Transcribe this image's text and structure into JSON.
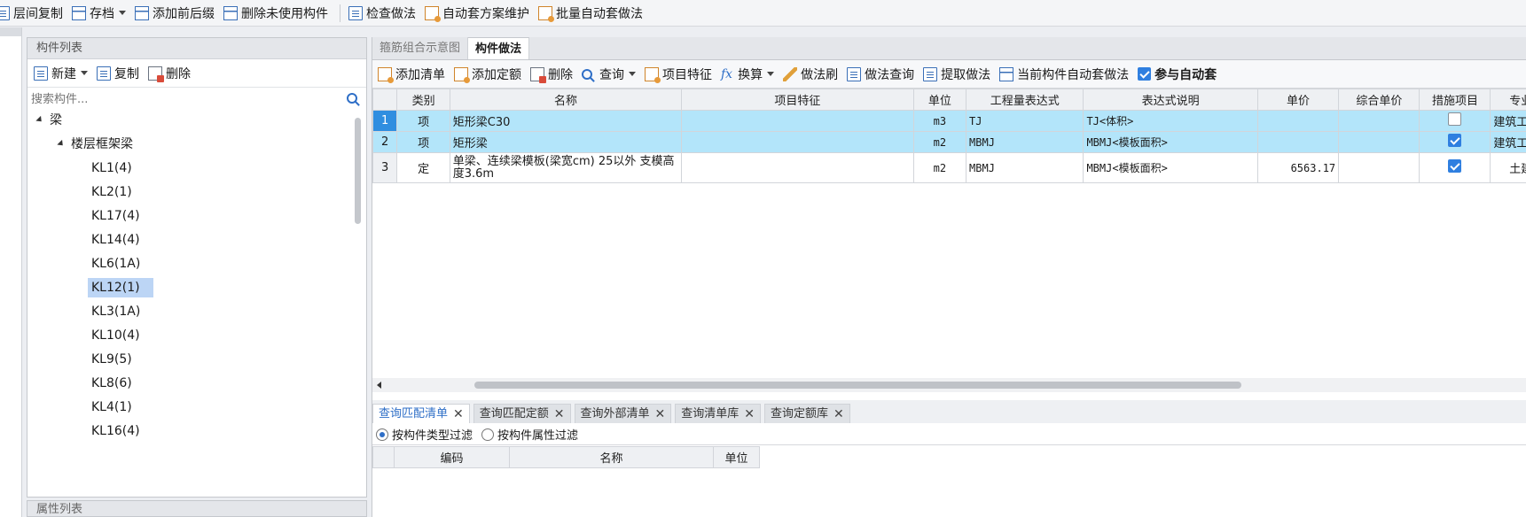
{
  "toolbar": {
    "items": [
      "层间复制",
      "存档",
      "添加前后缀",
      "删除未使用构件",
      "检查做法",
      "自动套方案维护",
      "批量自动套做法"
    ]
  },
  "component_panel": {
    "title": "构件列表",
    "tools": [
      "新建",
      "复制",
      "删除"
    ],
    "search_placeholder": "搜索构件...",
    "tree": {
      "root": "梁",
      "group": "楼层框架梁",
      "leaves": [
        "KL1(4)",
        "KL2(1)",
        "KL17(4)",
        "KL14(4)",
        "KL6(1A)",
        "KL12(1)",
        "KL3(1A)",
        "KL10(4)",
        "KL9(5)",
        "KL8(6)",
        "KL4(1)",
        "KL16(4)"
      ],
      "selected": "KL12(1)"
    }
  },
  "properties_panel": {
    "title": "属性列表"
  },
  "main": {
    "tabs": [
      "箍筋组合示意图",
      "构件做法"
    ],
    "active_tab": "构件做法",
    "tools": [
      "添加清单",
      "添加定额",
      "删除",
      "查询",
      "项目特征",
      "换算",
      "做法刷",
      "做法查询",
      "提取做法",
      "当前构件自动套做法",
      "参与自动套"
    ],
    "auto_apply_checked": true,
    "columns": [
      "类别",
      "名称",
      "项目特征",
      "单位",
      "工程量表达式",
      "表达式说明",
      "单价",
      "综合单价",
      "措施项目",
      "专业"
    ],
    "rows": [
      {
        "num": "1",
        "type": "项",
        "name": "矩形梁C30",
        "feature": "",
        "unit": "m3",
        "expr": "TJ",
        "desc": "TJ<体积>",
        "price": "",
        "total": "",
        "measure": false,
        "major": "建筑工"
      },
      {
        "num": "2",
        "type": "项",
        "name": "矩形梁",
        "feature": "",
        "unit": "m2",
        "expr": "MBMJ",
        "desc": "MBMJ<模板面积>",
        "price": "",
        "total": "",
        "measure": true,
        "major": "建筑工"
      },
      {
        "num": "3",
        "type": "定",
        "name": "单梁、连续梁模板(梁宽cm) 25以外 支模高度3.6m",
        "feature": "",
        "unit": "m2",
        "expr": "MBMJ",
        "desc": "MBMJ<模板面积>",
        "price": "6563.17",
        "total": "",
        "measure": true,
        "major": "土建"
      }
    ],
    "bottom_tabs": [
      "查询匹配清单",
      "查询匹配定额",
      "查询外部清单",
      "查询清单库",
      "查询定额库"
    ],
    "active_bottom_tab": "查询匹配清单",
    "filters": [
      "按构件类型过滤",
      "按构件属性过滤"
    ],
    "sub_columns": [
      "编码",
      "名称",
      "单位"
    ],
    "colors": {
      "highlight": "#b3e5fa",
      "selected_row_num": "#2f8ee0",
      "accent": "#2f7fe0"
    }
  }
}
